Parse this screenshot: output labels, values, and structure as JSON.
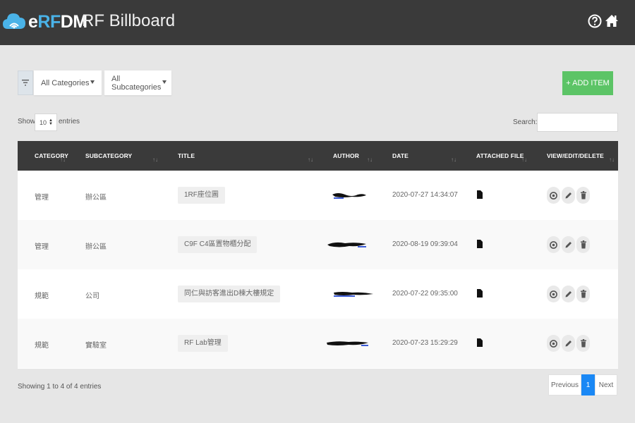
{
  "header": {
    "logo": {
      "e": "e",
      "rf": "RF",
      "dm": "DM"
    },
    "title": "RF Billboard",
    "icons": [
      "help-circle-icon",
      "home-icon"
    ]
  },
  "filters": {
    "filter_icon": "filter-icon",
    "category": "All Categories",
    "subcategory": "All Subcategories",
    "add_label": "+ ADD ITEM"
  },
  "length": {
    "show": "Show",
    "value": "10",
    "entries": "entries"
  },
  "search": {
    "label": "Search:",
    "value": ""
  },
  "table": {
    "headers": [
      "CATEGORY",
      "SUBCATEGORY",
      "TITLE",
      "AUTHOR",
      "DATE",
      "ATTACHED FILE",
      "VIEW/EDIT/DELETE"
    ],
    "sort_glyph": "↑↓",
    "rows": [
      {
        "category": "管理",
        "subcategory": "辦公區",
        "title": "1RF座位圖",
        "author": "[redacted]",
        "date": "2020-07-27 14:34:07"
      },
      {
        "category": "管理",
        "subcategory": "辦公區",
        "title": "C9F C4區置物櫃分配",
        "author": "[redacted]",
        "date": "2020-08-19 09:39:04"
      },
      {
        "category": "規範",
        "subcategory": "公司",
        "title": "同仁與訪客進出D棟大樓規定",
        "author": "[redacted]",
        "date": "2020-07-22 09:35:00"
      },
      {
        "category": "規範",
        "subcategory": "實驗室",
        "title": "RF Lab管理",
        "author": "[redacted]",
        "date": "2020-07-23 15:29:29"
      }
    ],
    "row_icons": [
      "file-icon",
      "eye-icon",
      "pencil-icon",
      "trash-icon"
    ]
  },
  "footer": {
    "info": "Showing 1 to 4 of 4 entries",
    "prev": "Previous",
    "page": "1",
    "next": "Next"
  },
  "colors": {
    "topbar": "#3a3a3a",
    "accent_blue": "#4ab3e8",
    "add_green": "#5cc466",
    "page_blue": "#1a88f5"
  }
}
